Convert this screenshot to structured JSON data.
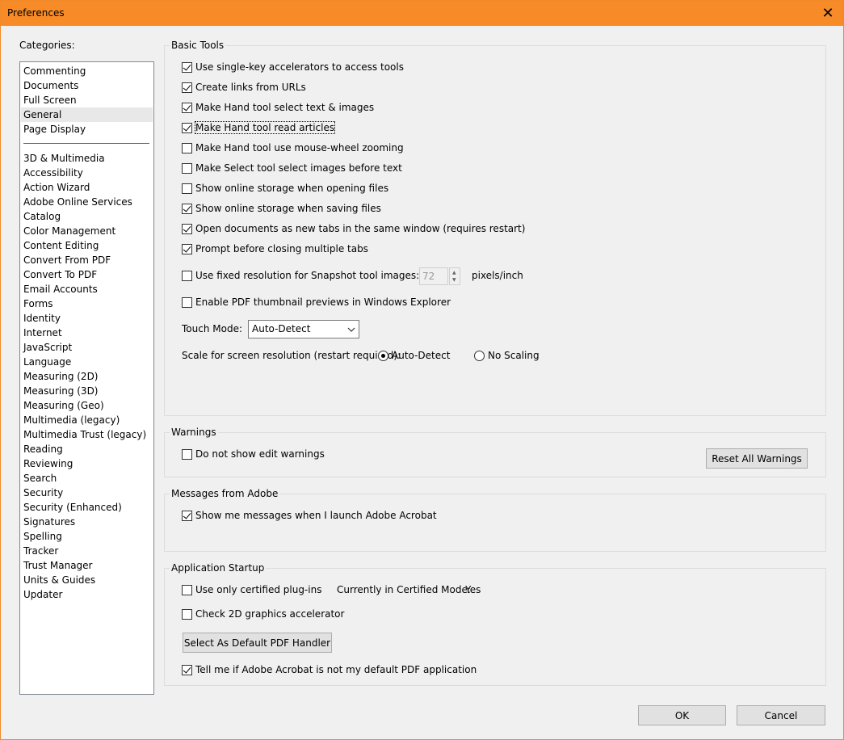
{
  "window": {
    "title": "Preferences",
    "close_glyph": "✕"
  },
  "categories": {
    "label": "Categories:",
    "items": [
      "Commenting",
      "Documents",
      "Full Screen",
      "General",
      "Page Display",
      "3D & Multimedia",
      "Accessibility",
      "Action Wizard",
      "Adobe Online Services",
      "Catalog",
      "Color Management",
      "Content Editing",
      "Convert From PDF",
      "Convert To PDF",
      "Email Accounts",
      "Forms",
      "Identity",
      "Internet",
      "JavaScript",
      "Language",
      "Measuring (2D)",
      "Measuring (3D)",
      "Measuring (Geo)",
      "Multimedia (legacy)",
      "Multimedia Trust (legacy)",
      "Reading",
      "Reviewing",
      "Search",
      "Security",
      "Security (Enhanced)",
      "Signatures",
      "Spelling",
      "Tracker",
      "Trust Manager",
      "Units & Guides",
      "Updater"
    ],
    "selected": "General"
  },
  "basic_tools": {
    "title": "Basic Tools",
    "options": [
      {
        "label": "Use single-key accelerators to access tools",
        "checked": true
      },
      {
        "label": "Create links from URLs",
        "checked": true
      },
      {
        "label": "Make Hand tool select text & images",
        "checked": true
      },
      {
        "label": "Make Hand tool read articles",
        "checked": true
      },
      {
        "label": "Make Hand tool use mouse-wheel zooming",
        "checked": false
      },
      {
        "label": "Make Select tool select images before text",
        "checked": false
      },
      {
        "label": "Show online storage when opening files",
        "checked": false
      },
      {
        "label": "Show online storage when saving files",
        "checked": true
      },
      {
        "label": "Open documents as new tabs in the same window (requires restart)",
        "checked": true
      },
      {
        "label": "Prompt before closing multiple tabs",
        "checked": true
      }
    ],
    "snapshot": {
      "label": "Use fixed resolution for Snapshot tool images:",
      "checked": false,
      "value": "72",
      "unit": "pixels/inch"
    },
    "thumbnail": {
      "label": "Enable PDF thumbnail previews in Windows Explorer",
      "checked": false
    },
    "touch_mode": {
      "label": "Touch Mode:",
      "value": "Auto-Detect"
    },
    "scale": {
      "label": "Scale for screen resolution (restart required):",
      "option_auto": "Auto-Detect",
      "option_none": "No Scaling",
      "selected": "Auto-Detect"
    }
  },
  "warnings": {
    "title": "Warnings",
    "option": {
      "label": "Do not show edit warnings",
      "checked": false
    },
    "reset_button": "Reset All Warnings"
  },
  "messages": {
    "title": "Messages from Adobe",
    "option": {
      "label": "Show me messages when I launch Adobe Acrobat",
      "checked": true
    }
  },
  "startup": {
    "title": "Application Startup",
    "certified": {
      "label": "Use only certified plug-ins",
      "checked": false
    },
    "certified_mode_label": "Currently in Certified Mode:",
    "certified_mode_value": "Yes",
    "graphics": {
      "label": "Check 2D graphics accelerator",
      "checked": false
    },
    "default_handler_button": "Select As Default PDF Handler",
    "tell_me": {
      "label": "Tell me if Adobe Acrobat is not my default PDF application",
      "checked": true
    }
  },
  "footer": {
    "ok": "OK",
    "cancel": "Cancel"
  }
}
